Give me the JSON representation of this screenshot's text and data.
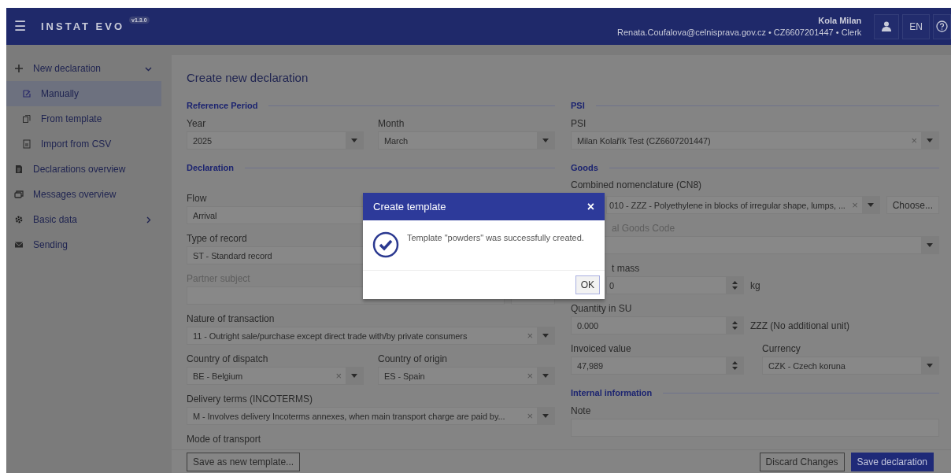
{
  "header": {
    "menu_icon": "☰",
    "title": "INSTAT EVO",
    "version": "v1.3.0",
    "user_name": "Kola Milan",
    "user_details": "Renata.Coufalova@celnisprava.gov.cz • CZ6607201447 • Clerk",
    "language": "EN"
  },
  "sidebar": {
    "items": [
      {
        "label": "New declaration",
        "expanded": true,
        "selected": false,
        "children": [
          {
            "label": "Manually",
            "selected": true
          },
          {
            "label": "From template",
            "selected": false
          },
          {
            "label": "Import from CSV",
            "selected": false
          }
        ]
      },
      {
        "label": "Declarations overview",
        "selected": false
      },
      {
        "label": "Messages overview",
        "selected": false
      },
      {
        "label": "Basic data",
        "expanded": false,
        "selected": false
      },
      {
        "label": "Sending",
        "selected": false
      }
    ]
  },
  "form": {
    "title": "Create new declaration",
    "left": [
      {
        "heading": "Reference Period",
        "rows": [
          [
            {
              "label": "Year",
              "value": "2025",
              "kind": "select",
              "disabled": false
            },
            {
              "label": "Month",
              "value": "March",
              "kind": "select",
              "disabled": false
            }
          ]
        ]
      },
      {
        "heading": "Declaration",
        "rows": [
          [
            {
              "label": "Flow",
              "value": "Arrival",
              "kind": "text",
              "disabled": false
            }
          ],
          [
            {
              "label": "Type of record",
              "value": "ST - Standard record",
              "kind": "text",
              "disabled": false
            }
          ],
          [
            {
              "label": "Partner subject",
              "kind": "lookup",
              "disabled": true
            }
          ],
          [
            {
              "label": "Nature of transaction",
              "value": "11 - Outright sale/purchase except direct trade with/by private consumers",
              "kind": "select",
              "clear": "×",
              "disabled": false
            }
          ],
          [
            {
              "label": "Country of dispatch",
              "value": "BE - Belgium",
              "kind": "select",
              "clear": "×",
              "disabled": false
            },
            {
              "label": "Country of origin",
              "value": "ES - Spain",
              "kind": "select",
              "clear": "×",
              "disabled": false
            }
          ],
          [
            {
              "label": "Delivery terms (INCOTERMS)",
              "value": "M - Involves delivery Incoterms annexes, when main transport charge are paid by...",
              "kind": "select",
              "clear": "×",
              "disabled": false
            }
          ],
          [
            {
              "label": "Mode of transport",
              "kind": "label_only",
              "disabled": false
            }
          ]
        ]
      }
    ],
    "right": [
      {
        "heading": "PSI",
        "rows": [
          [
            {
              "label": "PSI",
              "value": "Milan Kolařík Test (CZ6607201447)",
              "kind": "select",
              "clear": "×",
              "disabled": false
            }
          ]
        ]
      },
      {
        "heading": "Goods",
        "rows": [
          [
            {
              "label": "Combined nomenclature (CN8)",
              "value": "010 - ZZZ - Polyethylene in blocks of irregular shape, lumps, ...",
              "kind": "select",
              "clear": "×",
              "disabled": false,
              "value_covered": true,
              "action": "Choose..."
            }
          ],
          [
            {
              "label": "al Goods Code",
              "kind": "select",
              "disabled": true,
              "label_covered": true
            }
          ],
          [
            {
              "label": "t mass",
              "value": "0",
              "kind": "number",
              "unit": "kg",
              "disabled": false,
              "label_covered": true,
              "value_covered": true
            }
          ],
          [
            {
              "label": "Quantity in SU",
              "value": "0.000",
              "kind": "number",
              "unit": "ZZZ (No additional unit)",
              "disabled": false
            }
          ],
          [
            {
              "label": "Invoiced value",
              "value": "47,989",
              "kind": "number",
              "disabled": false
            },
            {
              "label": "Currency",
              "value": "CZK - Czech koruna",
              "kind": "select",
              "disabled": false
            }
          ]
        ]
      },
      {
        "heading": "Internal information",
        "rows": [
          [
            {
              "label": "Note",
              "kind": "text",
              "disabled": false
            }
          ]
        ]
      }
    ]
  },
  "footer": {
    "left_buttons": [
      {
        "label": "Save as new template...",
        "primary": false
      }
    ],
    "right_buttons": [
      {
        "label": "Discard Changes",
        "primary": false
      },
      {
        "label": "Save declaration",
        "primary": true
      }
    ]
  },
  "dialog": {
    "title": "Create template",
    "close": "×",
    "message": "Template \"powders\" was successfully created.",
    "button": "OK"
  }
}
